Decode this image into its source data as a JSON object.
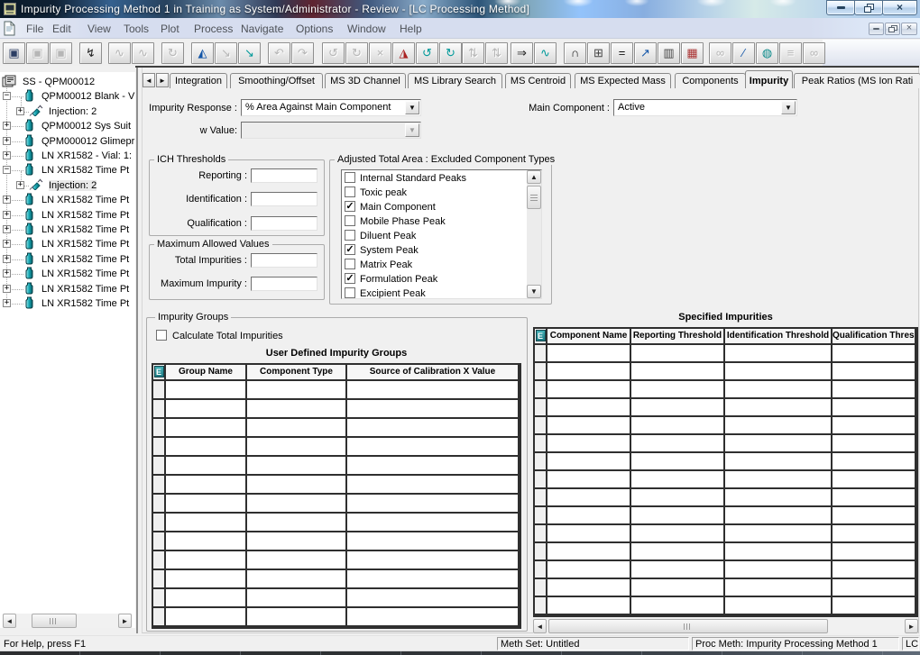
{
  "window": {
    "title": "Impurity Processing Method 1 in Training as System/Administrator - Review - [LC Processing Method]"
  },
  "menu": {
    "items": [
      "File",
      "Edit",
      "View",
      "Tools",
      "Plot",
      "Process",
      "Navigate",
      "Options",
      "Window",
      "Help"
    ]
  },
  "toolbar": {
    "buttons": [
      {
        "name": "save-method",
        "enabled": true
      },
      {
        "name": "save-copy",
        "enabled": false
      },
      {
        "name": "save-as",
        "enabled": false
      },
      {
        "name": "process-wizard",
        "enabled": true
      },
      {
        "name": "trace-a",
        "enabled": false
      },
      {
        "name": "trace-b",
        "enabled": false
      },
      {
        "name": "refresh",
        "enabled": false
      },
      {
        "name": "integrate-chart",
        "enabled": true
      },
      {
        "name": "dropper",
        "enabled": false
      },
      {
        "name": "dropper-apply",
        "enabled": true
      },
      {
        "name": "undo",
        "enabled": false
      },
      {
        "name": "redo",
        "enabled": false
      },
      {
        "name": "peak-undo",
        "enabled": false
      },
      {
        "name": "peak-redo",
        "enabled": false
      },
      {
        "name": "peak-delete",
        "enabled": false
      },
      {
        "name": "chart-update",
        "enabled": true
      },
      {
        "name": "drop-undo",
        "enabled": true
      },
      {
        "name": "drop-redo",
        "enabled": true
      },
      {
        "name": "sort-up-down-a",
        "enabled": false
      },
      {
        "name": "sort-up-down-b",
        "enabled": false
      },
      {
        "name": "run-sample",
        "enabled": true
      },
      {
        "name": "baseline-chart",
        "enabled": true
      },
      {
        "name": "peak-window",
        "enabled": true
      },
      {
        "name": "copy-pages",
        "enabled": true
      },
      {
        "name": "equals",
        "enabled": true
      },
      {
        "name": "edit-trace",
        "enabled": true
      },
      {
        "name": "paste-page",
        "enabled": true
      },
      {
        "name": "mini-chart",
        "enabled": true
      },
      {
        "name": "review-a",
        "enabled": false
      },
      {
        "name": "annotate-pen",
        "enabled": true
      },
      {
        "name": "database-disc",
        "enabled": true
      },
      {
        "name": "print",
        "enabled": false
      },
      {
        "name": "review-b",
        "enabled": false
      }
    ]
  },
  "tree": {
    "items": [
      {
        "label": "SS - QPM00012",
        "level": 0,
        "icon": "system-suitability-icon",
        "expander": null,
        "selected": false
      },
      {
        "label": "QPM00012 Blank - V",
        "level": 1,
        "icon": "vial-icon",
        "expander": "minus",
        "selected": false
      },
      {
        "label": "Injection: 2",
        "level": 2,
        "icon": "syringe-icon",
        "expander": "plus",
        "selected": false
      },
      {
        "label": "QPM00012 Sys Suit",
        "level": 1,
        "icon": "vial-icon",
        "expander": "plus",
        "selected": false
      },
      {
        "label": "QPM000012 Glimepr",
        "level": 1,
        "icon": "vial-icon",
        "expander": "plus",
        "selected": false
      },
      {
        "label": "LN XR1582  - Vial: 1:",
        "level": 1,
        "icon": "vial-icon",
        "expander": "plus",
        "selected": false
      },
      {
        "label": "LN XR1582 Time Pt",
        "level": 1,
        "icon": "vial-icon",
        "expander": "minus",
        "selected": false
      },
      {
        "label": "Injection: 2",
        "level": 2,
        "icon": "syringe-icon",
        "expander": "plus",
        "selected": true
      },
      {
        "label": "LN XR1582 Time Pt",
        "level": 1,
        "icon": "vial-icon",
        "expander": "plus",
        "selected": false
      },
      {
        "label": "LN XR1582 Time Pt",
        "level": 1,
        "icon": "vial-icon",
        "expander": "plus",
        "selected": false
      },
      {
        "label": "LN XR1582 Time Pt",
        "level": 1,
        "icon": "vial-icon",
        "expander": "plus",
        "selected": false
      },
      {
        "label": "LN XR1582 Time Pt",
        "level": 1,
        "icon": "vial-icon",
        "expander": "plus",
        "selected": false
      },
      {
        "label": "LN XR1582 Time Pt",
        "level": 1,
        "icon": "vial-icon",
        "expander": "plus",
        "selected": false
      },
      {
        "label": "LN XR1582 Time Pt",
        "level": 1,
        "icon": "vial-icon",
        "expander": "plus",
        "selected": false
      },
      {
        "label": "LN XR1582 Time Pt",
        "level": 1,
        "icon": "vial-icon",
        "expander": "plus",
        "selected": false
      },
      {
        "label": "LN XR1582 Time Pt",
        "level": 1,
        "icon": "vial-icon",
        "expander": "plus",
        "selected": false
      }
    ]
  },
  "tabs": {
    "items": [
      {
        "label": "Integration",
        "selected": false
      },
      {
        "label": "Smoothing/Offset",
        "selected": false
      },
      {
        "label": "MS 3D Channel",
        "selected": false
      },
      {
        "label": "MS Library Search",
        "selected": false
      },
      {
        "label": "MS Centroid",
        "selected": false
      },
      {
        "label": "MS Expected Mass",
        "selected": false
      },
      {
        "label": "Components",
        "selected": false
      },
      {
        "label": "Impurity",
        "selected": true
      },
      {
        "label": "Peak Ratios (MS Ion Rati",
        "selected": false
      }
    ]
  },
  "impurity": {
    "impurity_response": {
      "label": "Impurity Response :",
      "value": "% Area Against Main Component"
    },
    "main_component": {
      "label": "Main Component :",
      "value": "Active"
    },
    "w_value": {
      "label": "w Value:",
      "value": ""
    },
    "ich_thresholds": {
      "title": "ICH Thresholds",
      "fields": [
        {
          "label": "Reporting :",
          "value": ""
        },
        {
          "label": "Identification :",
          "value": ""
        },
        {
          "label": "Qualification :",
          "value": ""
        }
      ]
    },
    "max_allowed": {
      "title": "Maximum Allowed Values",
      "fields": [
        {
          "label": "Total Impurities :",
          "value": ""
        },
        {
          "label": "Maximum Impurity :",
          "value": ""
        }
      ]
    },
    "adjusted_total_area": {
      "title": "Adjusted Total Area : Excluded Component Types",
      "items": [
        {
          "label": "Internal Standard Peaks",
          "checked": false
        },
        {
          "label": "Toxic peak",
          "checked": false
        },
        {
          "label": "Main Component",
          "checked": true
        },
        {
          "label": "Mobile Phase Peak",
          "checked": false
        },
        {
          "label": "Diluent Peak",
          "checked": false
        },
        {
          "label": "System Peak",
          "checked": true
        },
        {
          "label": "Matrix Peak",
          "checked": false
        },
        {
          "label": "Formulation Peak",
          "checked": true
        },
        {
          "label": "Excipient Peak",
          "checked": false
        }
      ]
    },
    "impurity_groups": {
      "title": "Impurity Groups",
      "checkbox_label": "Calculate Total Impurities",
      "checked": false,
      "table_title": "User Defined Impurity Groups",
      "columns": [
        "Group Name",
        "Component Type",
        "Source of Calibration X Value"
      ],
      "row_count": 13
    },
    "specified_impurities": {
      "title": "Specified Impurities",
      "columns": [
        "Component Name",
        "Reporting Threshold",
        "Identification Threshold",
        "Qualification Threshold"
      ],
      "row_count": 15
    }
  },
  "statusbar": {
    "help": "For Help, press F1",
    "meth_set": "Meth Set: Untitled",
    "proc_meth": "Proc Meth: Impurity Processing Method 1",
    "mode": "LC"
  }
}
